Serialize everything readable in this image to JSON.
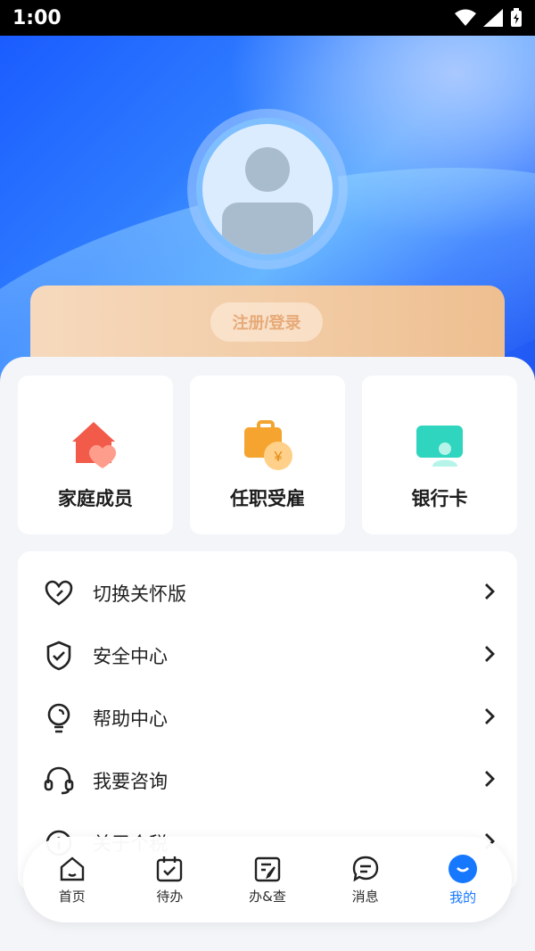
{
  "status": {
    "time": "1:00"
  },
  "profile": {
    "login_label": "注册/登录"
  },
  "quick": [
    {
      "label": "家庭成员",
      "icon": "family-house-heart-icon"
    },
    {
      "label": "任职受雇",
      "icon": "employment-briefcase-icon"
    },
    {
      "label": "银行卡",
      "icon": "bank-card-icon"
    }
  ],
  "menu": [
    {
      "label": "切换关怀版",
      "icon": "heart-icon"
    },
    {
      "label": "安全中心",
      "icon": "shield-check-icon"
    },
    {
      "label": "帮助中心",
      "icon": "lightbulb-icon"
    },
    {
      "label": "我要咨询",
      "icon": "headset-icon"
    },
    {
      "label": "关于个税",
      "icon": "info-circle-icon"
    }
  ],
  "nav": [
    {
      "label": "首页",
      "icon": "home-icon",
      "active": false
    },
    {
      "label": "待办",
      "icon": "calendar-check-icon",
      "active": false
    },
    {
      "label": "办&查",
      "icon": "document-search-icon",
      "active": false
    },
    {
      "label": "消息",
      "icon": "chat-bubble-icon",
      "active": false
    },
    {
      "label": "我的",
      "icon": "smile-icon",
      "active": true
    }
  ],
  "colors": {
    "accent": "#1677ff",
    "hero": "#2f7dff",
    "login_card": "#f2cda8"
  }
}
